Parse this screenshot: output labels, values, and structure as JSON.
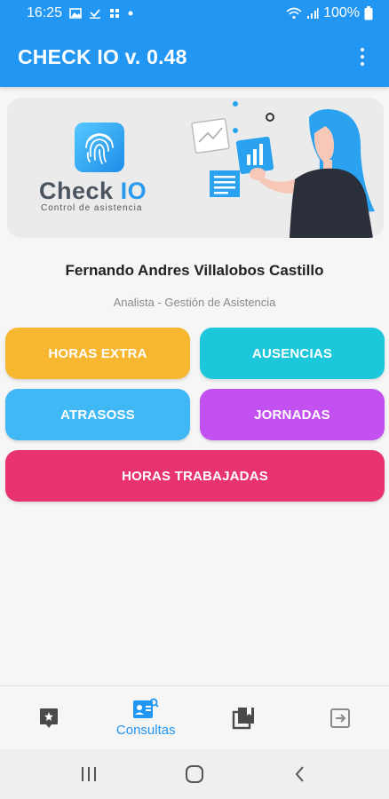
{
  "status_bar": {
    "time": "16:25",
    "battery": "100%"
  },
  "app_bar": {
    "title": "CHECK IO v. 0.48",
    "menu_icon": "more-vert-icon"
  },
  "banner": {
    "logo_word": "Check",
    "logo_io": "IO",
    "logo_subtitle": "Control de asistencia"
  },
  "user": {
    "name": "Fernando Andres Villalobos Castillo",
    "role": "Analista - Gestión de Asistencia"
  },
  "buttons": {
    "horas_extra": "HORAS EXTRA",
    "ausencias": "AUSENCIAS",
    "atrasos": "ATRASOSS",
    "jornadas": "JORNADAS",
    "horas_trabajadas": "HORAS TRABAJADAS"
  },
  "colors": {
    "primary": "#2196f3",
    "horas_extra": "#f7b731",
    "ausencias": "#1cc7dc",
    "atrasos": "#3fb8f5",
    "jornadas": "#c350f0",
    "horas_trabajadas": "#e8336f"
  },
  "bottom_nav": {
    "items": [
      {
        "icon": "star-badge-icon",
        "label": ""
      },
      {
        "icon": "contact-card-icon",
        "label": "Consultas"
      },
      {
        "icon": "library-icon",
        "label": ""
      },
      {
        "icon": "exit-icon",
        "label": ""
      }
    ],
    "selected": "Consultas"
  },
  "system_nav": {
    "recents": "recents-icon",
    "home": "home-icon",
    "back": "back-icon"
  }
}
